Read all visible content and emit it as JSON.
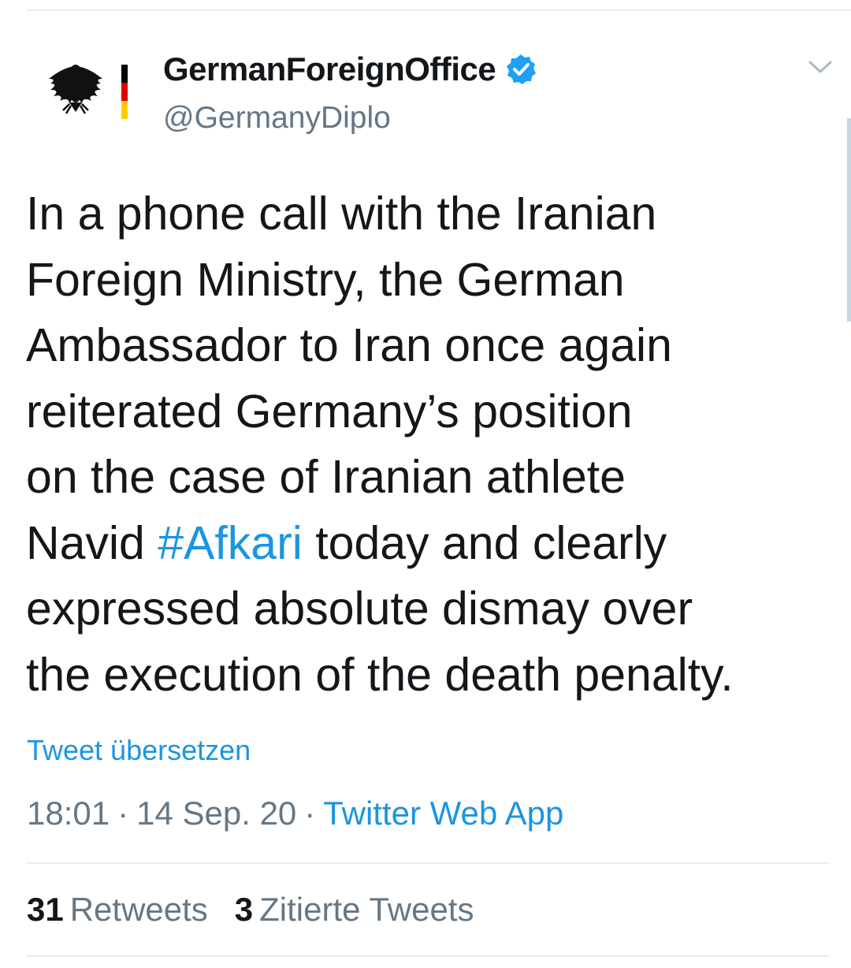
{
  "tweet": {
    "author": {
      "display_name": "GermanForeignOffice",
      "handle": "@GermanyDiplo",
      "avatar_icon": "federal-eagle-icon",
      "verified_icon": "verified-badge-icon"
    },
    "menu_icon": "chevron-down-icon",
    "text_lines": [
      {
        "before": "In a phone call with the Iranian"
      },
      {
        "before": "Foreign Ministry, the German"
      },
      {
        "before": "Ambassador to Iran once again"
      },
      {
        "before": "reiterated Germany’s position"
      },
      {
        "before": "on the case of Iranian athlete"
      },
      {
        "before": "Navid ",
        "hashtag": "#Afkari",
        "after": " today and clearly"
      },
      {
        "before": "expressed absolute dismay over"
      },
      {
        "before": "the execution of the death penalty."
      }
    ],
    "translate_label": "Tweet übersetzen",
    "time": "18:01",
    "separator": "·",
    "date": "14 Sep. 20",
    "source": "Twitter Web App",
    "stats": {
      "retweets_count": "31",
      "retweets_label": "Retweets",
      "quotes_count": "3",
      "quotes_label": "Zitierte Tweets"
    }
  },
  "colors": {
    "text": "#14171a",
    "secondary": "#657786",
    "link": "#1b95e0",
    "verified": "#1da1f2",
    "divider": "#e6ecf0"
  }
}
